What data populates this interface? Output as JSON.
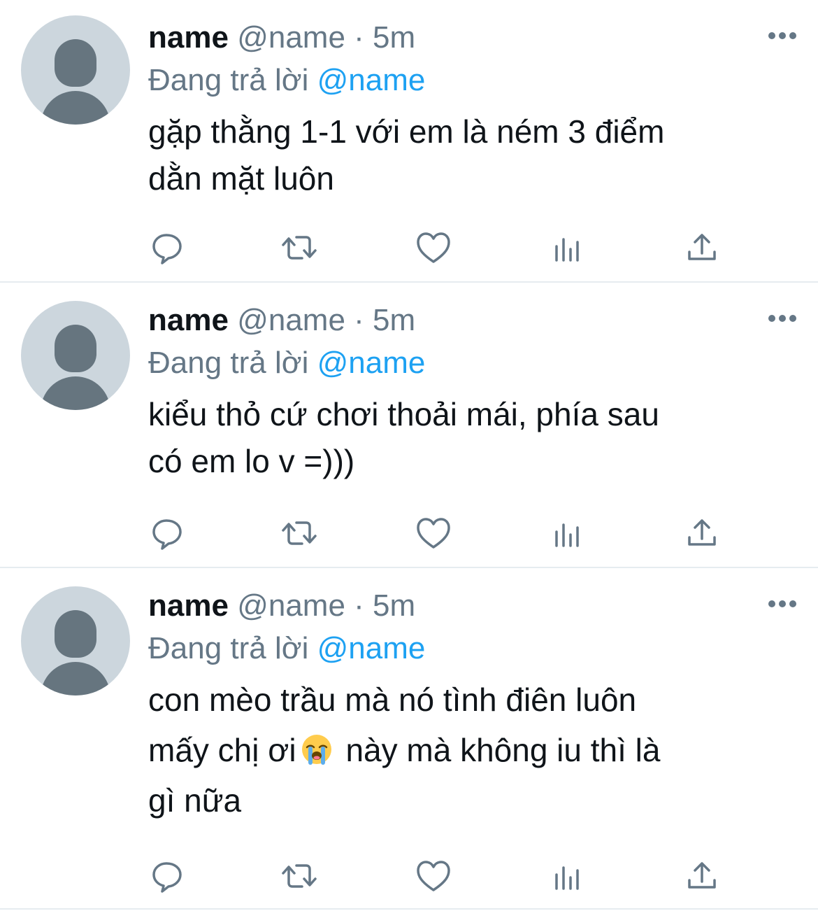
{
  "tweets": [
    {
      "name": "name",
      "handle": "@name",
      "separator": "·",
      "time": "5m",
      "reply_prefix": "Đang trả lời",
      "reply_to": "@name",
      "text": "gặp thằng 1-1 với em là ném 3 điểm\ndằn mặt luôn"
    },
    {
      "name": "name",
      "handle": "@name",
      "separator": "·",
      "time": "5m",
      "reply_prefix": "Đang trả lời",
      "reply_to": "@name",
      "text": "kiểu thỏ cứ chơi thoải mái, phía sau\ncó em lo v =)))"
    },
    {
      "name": "name",
      "handle": "@name",
      "separator": "·",
      "time": "5m",
      "reply_prefix": "Đang trả lời",
      "reply_to": "@name",
      "text_before_emoji": "con mèo trầu mà nó tình điên luôn\nmấy chị ơi",
      "emoji": "loudly-crying-face",
      "text_after_emoji": "này mà không iu thì là\ngì nữa"
    }
  ],
  "icons": {
    "more": "more-dots-icon",
    "reply": "reply-bubble-icon",
    "retweet": "retweet-icon",
    "like": "heart-icon",
    "views": "views-chart-icon",
    "share": "share-upload-icon"
  },
  "colors": {
    "text_primary": "#0f1419",
    "text_secondary": "#657786",
    "mention": "#1da1f2",
    "avatar_bg": "#ccd6dd",
    "avatar_fg": "#66757f",
    "divider": "#e6ecf0"
  }
}
